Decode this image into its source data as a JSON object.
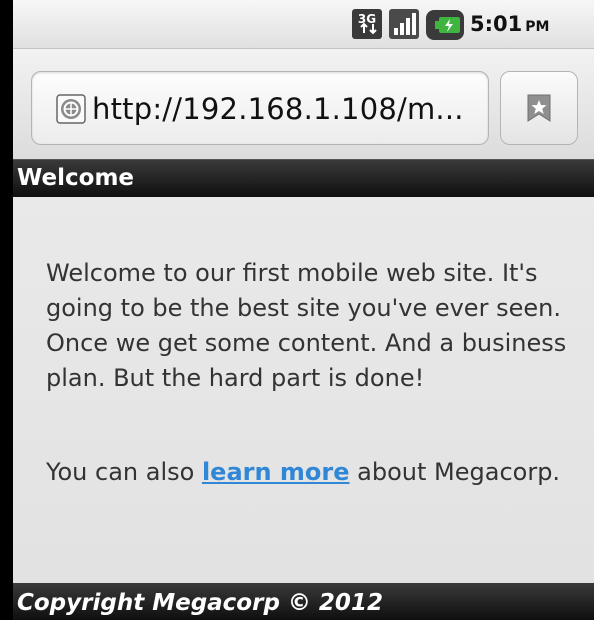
{
  "status_bar": {
    "network_label": "3G",
    "clock_time": "5:01",
    "clock_ampm": "PM",
    "colors": {
      "battery": "#3fb43f",
      "signal": "#333333"
    }
  },
  "browser": {
    "url": "http://192.168.1.108/m...",
    "icons": {
      "site": "globe-icon",
      "bookmark": "bookmark-icon"
    }
  },
  "page": {
    "header_title": "Welcome",
    "paragraph1": "Welcome to our first mobile web site. It's going to be the best site you've ever seen. Once we get some content. And a business plan. But the hard part is done!",
    "paragraph2_before": "You can also ",
    "link_text": "learn more",
    "paragraph2_after": " about Megacorp.",
    "footer": "Copyright Megacorp © 2012",
    "colors": {
      "link": "#2f87d6",
      "bar": "#1a1a1a",
      "text": "#333333"
    }
  }
}
